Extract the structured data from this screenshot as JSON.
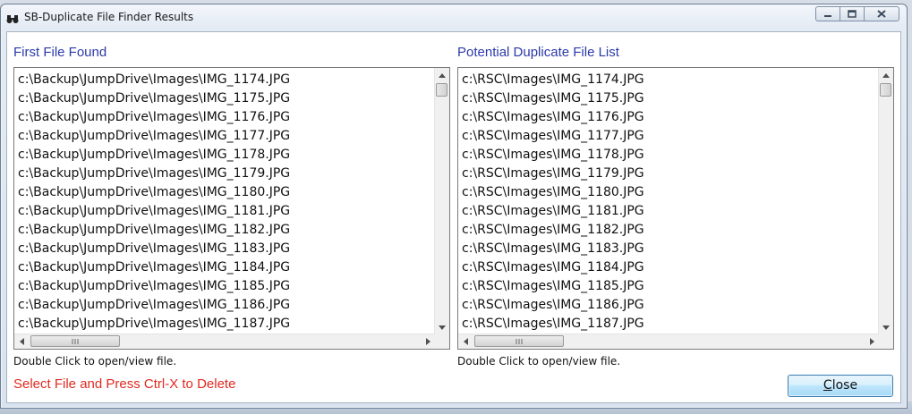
{
  "window": {
    "title": "SB-Duplicate File Finder Results",
    "app_icon": "binoculars-icon"
  },
  "left": {
    "label": "First File Found",
    "items": [
      "c:\\Backup\\JumpDrive\\Images\\IMG_1174.JPG",
      "c:\\Backup\\JumpDrive\\Images\\IMG_1175.JPG",
      "c:\\Backup\\JumpDrive\\Images\\IMG_1176.JPG",
      "c:\\Backup\\JumpDrive\\Images\\IMG_1177.JPG",
      "c:\\Backup\\JumpDrive\\Images\\IMG_1178.JPG",
      "c:\\Backup\\JumpDrive\\Images\\IMG_1179.JPG",
      "c:\\Backup\\JumpDrive\\Images\\IMG_1180.JPG",
      "c:\\Backup\\JumpDrive\\Images\\IMG_1181.JPG",
      "c:\\Backup\\JumpDrive\\Images\\IMG_1182.JPG",
      "c:\\Backup\\JumpDrive\\Images\\IMG_1183.JPG",
      "c:\\Backup\\JumpDrive\\Images\\IMG_1184.JPG",
      "c:\\Backup\\JumpDrive\\Images\\IMG_1185.JPG",
      "c:\\Backup\\JumpDrive\\Images\\IMG_1186.JPG",
      "c:\\Backup\\JumpDrive\\Images\\IMG_1187.JPG"
    ],
    "hint": "Double Click to open/view file."
  },
  "right": {
    "label": "Potential Duplicate File List",
    "items": [
      "c:\\RSC\\Images\\IMG_1174.JPG",
      "c:\\RSC\\Images\\IMG_1175.JPG",
      "c:\\RSC\\Images\\IMG_1176.JPG",
      "c:\\RSC\\Images\\IMG_1177.JPG",
      "c:\\RSC\\Images\\IMG_1178.JPG",
      "c:\\RSC\\Images\\IMG_1179.JPG",
      "c:\\RSC\\Images\\IMG_1180.JPG",
      "c:\\RSC\\Images\\IMG_1181.JPG",
      "c:\\RSC\\Images\\IMG_1182.JPG",
      "c:\\RSC\\Images\\IMG_1183.JPG",
      "c:\\RSC\\Images\\IMG_1184.JPG",
      "c:\\RSC\\Images\\IMG_1185.JPG",
      "c:\\RSC\\Images\\IMG_1186.JPG",
      "c:\\RSC\\Images\\IMG_1187.JPG"
    ],
    "hint": "Double Click to open/view file."
  },
  "footer": {
    "delete_hint": "Select File and Press Ctrl-X to Delete",
    "close_mnemonic": "C",
    "close_rest": "lose"
  },
  "colors": {
    "label_blue": "#2b3aa8",
    "delete_red": "#e02a20"
  }
}
